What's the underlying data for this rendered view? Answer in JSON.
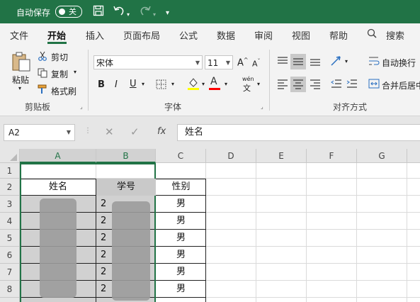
{
  "titlebar": {
    "autosave_label": "自动保存",
    "autosave_state": "关",
    "save_icon": "save-icon",
    "undo_icon": "undo-icon",
    "redo_icon": "redo-icon",
    "customize_icon": "customize-qat-icon"
  },
  "menu": {
    "tabs": [
      "文件",
      "开始",
      "插入",
      "页面布局",
      "公式",
      "数据",
      "审阅",
      "视图",
      "帮助"
    ],
    "active_tab": "开始",
    "search_label": "搜索"
  },
  "ribbon": {
    "clipboard": {
      "paste": "粘贴",
      "cut": "剪切",
      "copy": "复制",
      "format_painter": "格式刷",
      "group": "剪贴板"
    },
    "font": {
      "font_name": "宋体",
      "font_size": "11",
      "bold": "B",
      "italic": "I",
      "underline": "U",
      "grow": "A",
      "shrink": "A",
      "font_color": "A",
      "phonetic": "wén",
      "group": "字体"
    },
    "alignment": {
      "wrap_text": "自动换行",
      "merge_center": "合并后居中",
      "group": "对齐方式"
    }
  },
  "formula_bar": {
    "name_box": "A2",
    "fx": "fx",
    "content": "姓名"
  },
  "grid": {
    "columns": [
      "A",
      "B",
      "C",
      "D",
      "E",
      "F",
      "G"
    ],
    "rows": [
      "1",
      "2",
      "3",
      "4",
      "5",
      "6",
      "7",
      "8"
    ],
    "header_row": {
      "A": "姓名",
      "B": "学号",
      "C": "性别"
    },
    "partial_b": [
      "2",
      "2",
      "2",
      "2",
      "2",
      "2"
    ],
    "gender": [
      "男",
      "男",
      "男",
      "男",
      "男",
      "男"
    ]
  },
  "colors": {
    "accent": "#217346",
    "font_color_bar": "#ff0000",
    "highlight_bar": "#ffff00"
  }
}
